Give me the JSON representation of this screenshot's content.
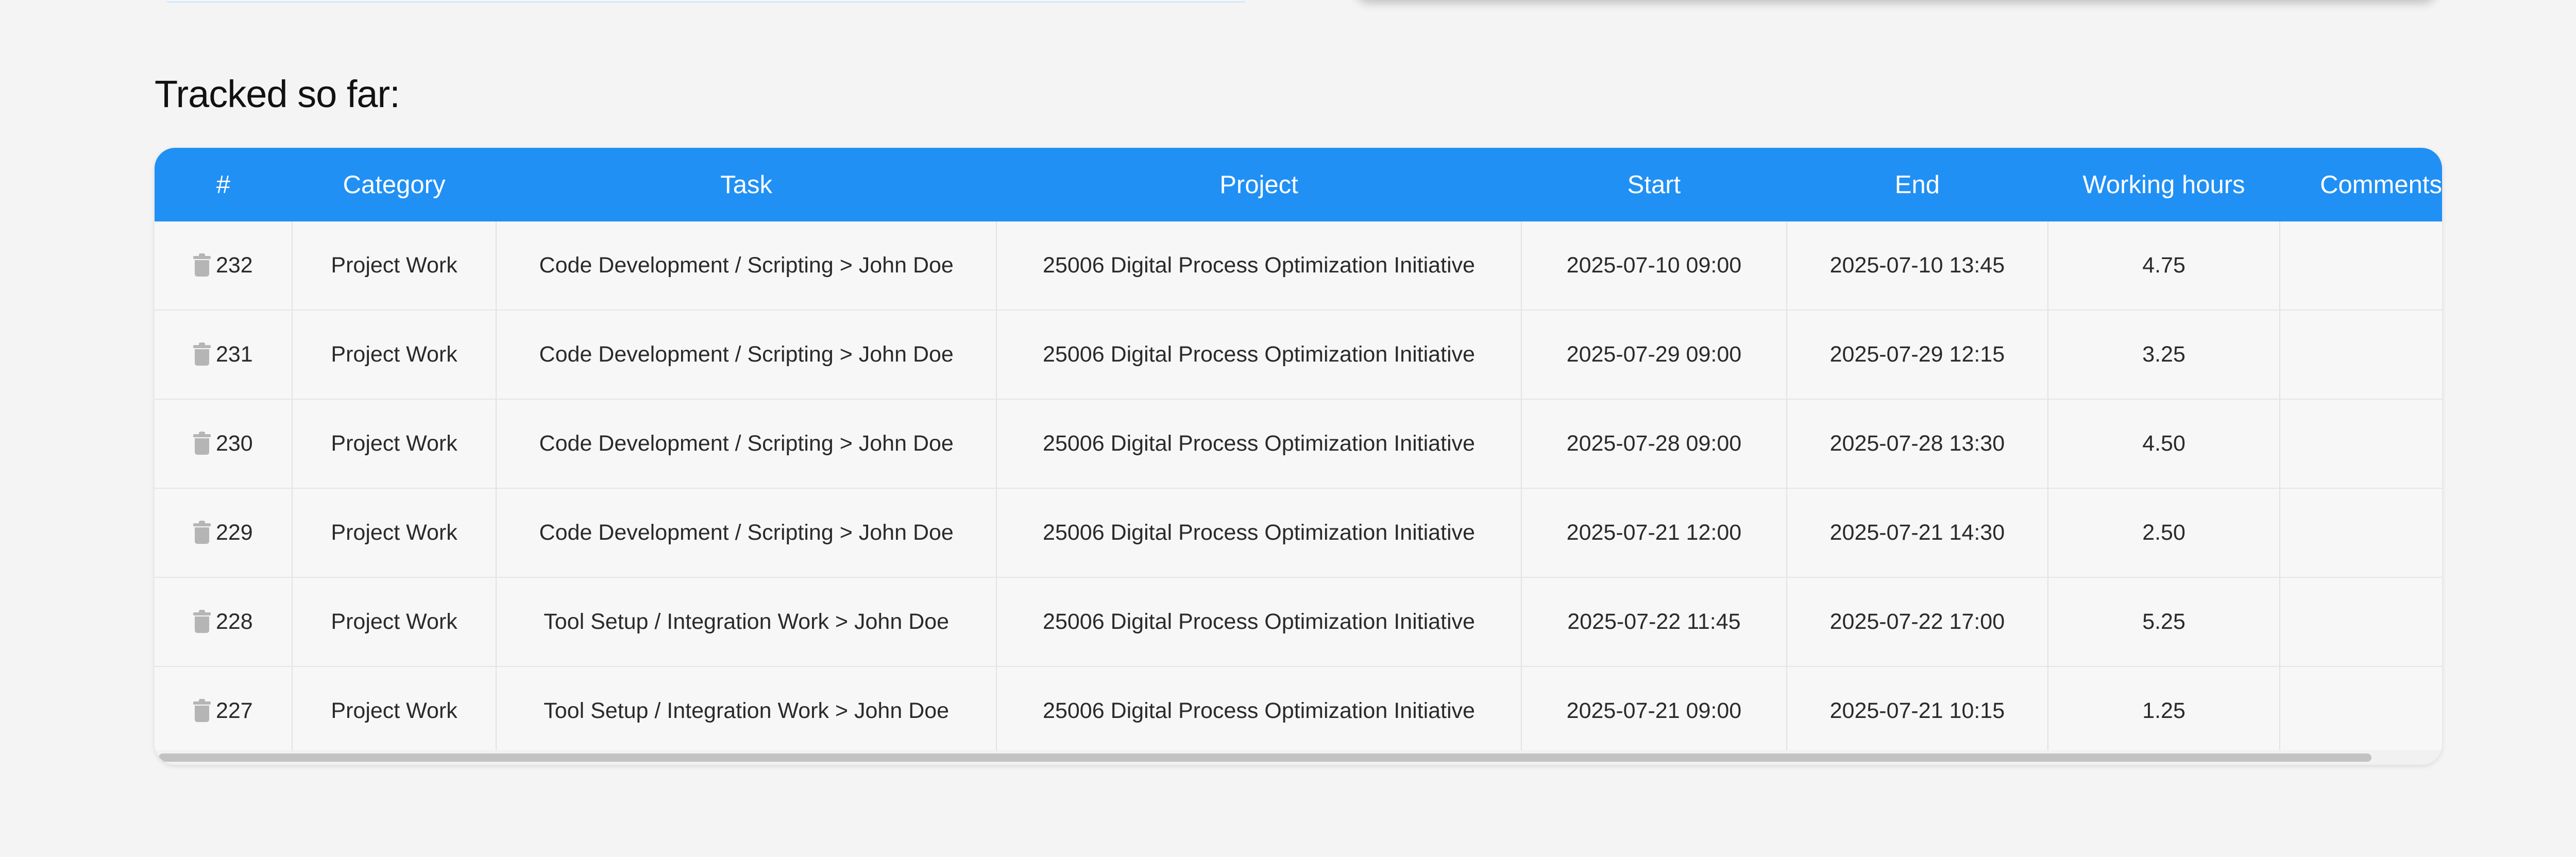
{
  "section_title": "Tracked so far:",
  "table": {
    "headers": [
      "#",
      "Category",
      "Task",
      "Project",
      "Start",
      "End",
      "Working hours",
      "Comments"
    ],
    "rows": [
      {
        "id": "232",
        "category": "Project Work",
        "task": "Code Development / Scripting > John Doe",
        "project": "25006 Digital Process Optimization Initiative",
        "start": "2025-07-10 09:00",
        "end": "2025-07-10 13:45",
        "hours": "4.75",
        "comment": ""
      },
      {
        "id": "231",
        "category": "Project Work",
        "task": "Code Development / Scripting > John Doe",
        "project": "25006 Digital Process Optimization Initiative",
        "start": "2025-07-29 09:00",
        "end": "2025-07-29 12:15",
        "hours": "3.25",
        "comment": ""
      },
      {
        "id": "230",
        "category": "Project Work",
        "task": "Code Development / Scripting > John Doe",
        "project": "25006 Digital Process Optimization Initiative",
        "start": "2025-07-28 09:00",
        "end": "2025-07-28 13:30",
        "hours": "4.50",
        "comment": ""
      },
      {
        "id": "229",
        "category": "Project Work",
        "task": "Code Development / Scripting > John Doe",
        "project": "25006 Digital Process Optimization Initiative",
        "start": "2025-07-21 12:00",
        "end": "2025-07-21 14:30",
        "hours": "2.50",
        "comment": ""
      },
      {
        "id": "228",
        "category": "Project Work",
        "task": "Tool Setup / Integration Work > John Doe",
        "project": "25006 Digital Process Optimization Initiative",
        "start": "2025-07-22 11:45",
        "end": "2025-07-22 17:00",
        "hours": "5.25",
        "comment": ""
      },
      {
        "id": "227",
        "category": "Project Work",
        "task": "Tool Setup / Integration Work > John Doe",
        "project": "25006 Digital Process Optimization Initiative",
        "start": "2025-07-21 09:00",
        "end": "2025-07-21 10:15",
        "hours": "1.25",
        "comment": ""
      }
    ]
  },
  "icons": {
    "delete": "trash-icon"
  },
  "colors": {
    "header_bg": "#2090f4",
    "header_text": "#ffffff",
    "background": "#f4f4f4"
  }
}
